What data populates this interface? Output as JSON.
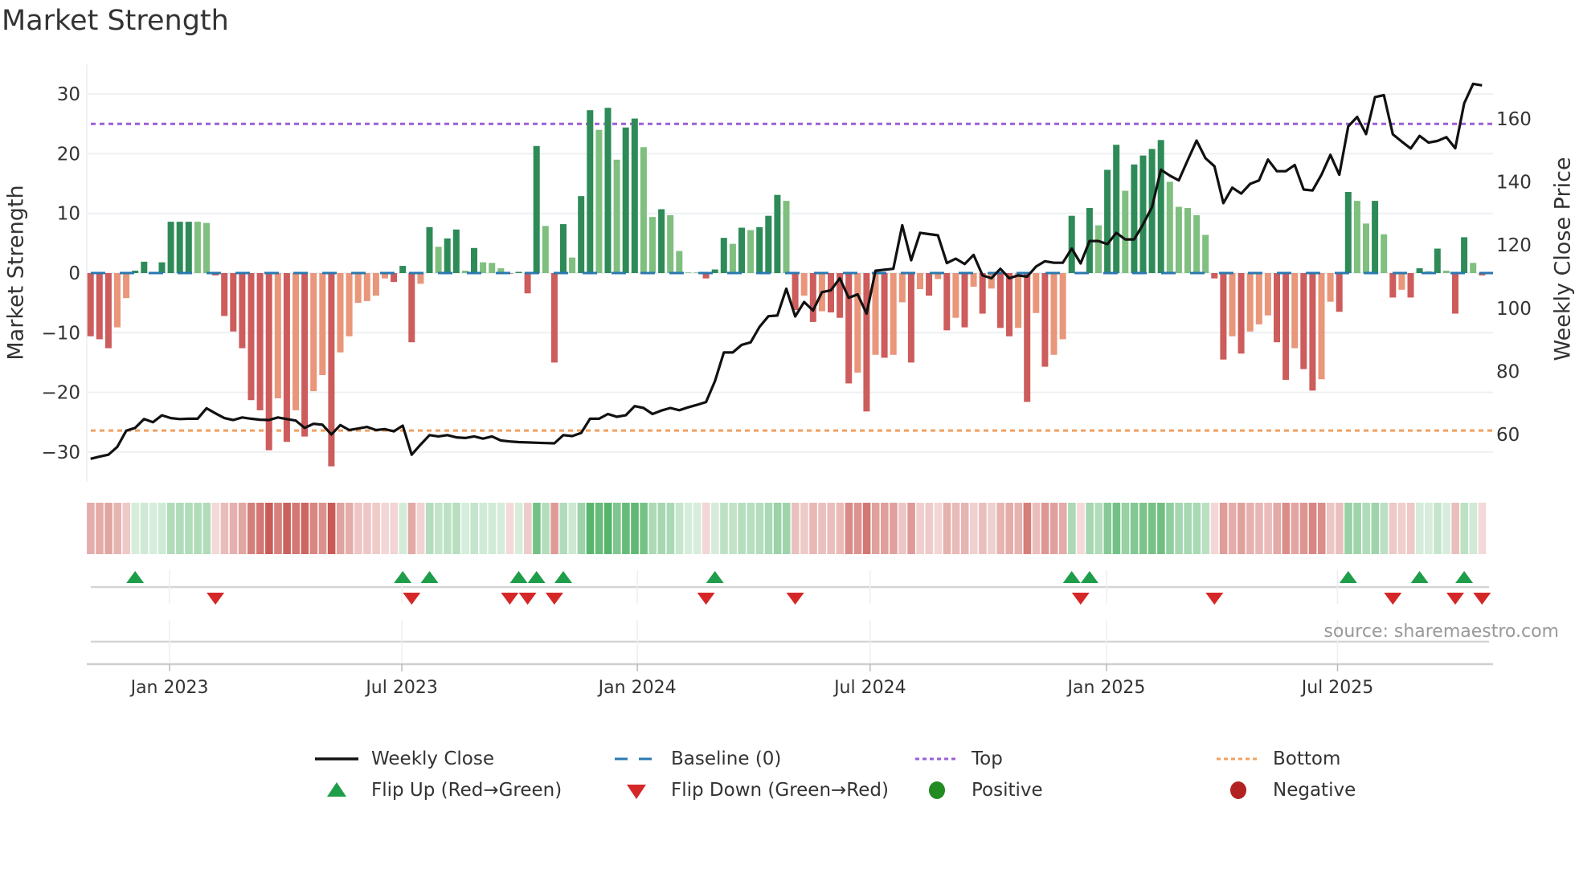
{
  "title": "Market Strength",
  "source": "source: sharemaestro.com",
  "colors": {
    "dark_green": "#2e8b57",
    "light_green": "#7fbf7f",
    "dark_red": "#cd5c5c",
    "salmon": "#e9967a",
    "baseline": "#2a78b0",
    "top": "#9b5fd6",
    "bottom": "#f0a060",
    "close": "#111111",
    "flip_up": "#1e9e4a",
    "flip_down": "#d62728",
    "positive": "#228b22",
    "negative": "#b22222",
    "heat_green": "#4caf62",
    "heat_red": "#c95a55"
  },
  "legend": [
    {
      "key": "close",
      "label": "Weekly Close"
    },
    {
      "key": "baseline",
      "label": "Baseline (0)"
    },
    {
      "key": "top",
      "label": "Top"
    },
    {
      "key": "bottom",
      "label": "Bottom"
    },
    {
      "key": "flip_up",
      "label": "Flip Up (Red→Green)"
    },
    {
      "key": "flip_down",
      "label": "Flip Down (Green→Red)"
    },
    {
      "key": "positive",
      "label": "Positive"
    },
    {
      "key": "negative",
      "label": "Negative"
    }
  ],
  "chart_data": {
    "type": "bar",
    "title": "Market Strength",
    "ylabel": "Market Strength",
    "y2label": "Weekly Close Price",
    "xlabel": "",
    "ylim": [
      -35,
      35
    ],
    "y2lim": [
      45,
      177.3
    ],
    "yticks": [
      {
        "v": -30,
        "label": "−30"
      },
      {
        "v": -20,
        "label": "−20"
      },
      {
        "v": -10,
        "label": "−10"
      },
      {
        "v": 0,
        "label": "0"
      },
      {
        "v": 10,
        "label": "10"
      },
      {
        "v": 20,
        "label": "20"
      },
      {
        "v": 30,
        "label": "30"
      }
    ],
    "y2ticks": [
      {
        "v": 60,
        "label": "60"
      },
      {
        "v": 80,
        "label": "80"
      },
      {
        "v": 100,
        "label": "100"
      },
      {
        "v": 120,
        "label": "120"
      },
      {
        "v": 140,
        "label": "140"
      },
      {
        "v": 160,
        "label": "160"
      }
    ],
    "xticks": [
      {
        "label": "Jan 2023",
        "week": 9.86
      },
      {
        "label": "Jul 2023",
        "week": 35.9
      },
      {
        "label": "Jan 2024",
        "week": 62.3
      },
      {
        "label": "Jul 2024",
        "week": 88.4
      },
      {
        "label": "Jan 2025",
        "week": 114.9
      },
      {
        "label": "Jul 2025",
        "week": 140.8
      }
    ],
    "grid": true,
    "top_level": 25,
    "bottom_level": -26.4,
    "baseline": 0,
    "strength": [
      -10.6,
      -11.1,
      -12.6,
      -9.1,
      -4.2,
      0.4,
      1.9,
      0.1,
      1.8,
      8.6,
      8.6,
      8.6,
      8.6,
      8.4,
      -0.4,
      -7.2,
      -9.8,
      -12.6,
      -21.3,
      -23.0,
      -29.7,
      -21.0,
      -28.3,
      -23.0,
      -27.4,
      -19.8,
      -17.1,
      -32.4,
      -13.3,
      -10.6,
      -5.0,
      -4.7,
      -3.8,
      -0.9,
      -1.5,
      1.2,
      -11.6,
      -1.8,
      7.7,
      4.4,
      5.8,
      7.3,
      0.4,
      4.2,
      1.8,
      1.7,
      0.8,
      -0.1,
      0.2,
      -3.4,
      21.3,
      7.9,
      -15.0,
      8.2,
      2.6,
      12.9,
      27.3,
      24.0,
      27.7,
      19.0,
      24.4,
      25.9,
      21.1,
      9.4,
      10.7,
      9.7,
      3.7,
      0.1,
      0.1,
      -0.9,
      0.6,
      5.9,
      4.9,
      7.6,
      7.2,
      7.7,
      9.6,
      13.1,
      12.1,
      -6.2,
      -3.8,
      -8.2,
      -6.4,
      -6.6,
      -7.5,
      -18.5,
      -16.7,
      -23.2,
      -13.7,
      -14.2,
      -13.7,
      -4.9,
      -15.0,
      -2.7,
      -3.8,
      -1.0,
      -9.6,
      -7.5,
      -9.1,
      -2.3,
      -6.8,
      -2.6,
      -9.2,
      -10.6,
      -9.2,
      -21.6,
      -6.7,
      -15.7,
      -13.7,
      -11.1,
      9.6,
      -0.2,
      10.9,
      8.0,
      17.3,
      21.5,
      13.8,
      18.2,
      19.7,
      20.8,
      22.3,
      15.3,
      11.1,
      10.9,
      9.7,
      6.4,
      -0.9,
      -14.5,
      -10.6,
      -13.5,
      -9.8,
      -8.6,
      -7.1,
      -11.6,
      -17.9,
      -12.6,
      -16.1,
      -19.7,
      -17.8,
      -4.8,
      -6.5,
      13.6,
      12.1,
      8.3,
      12.1,
      6.5,
      -4.1,
      -2.8,
      -4.1,
      0.8,
      0.3,
      4.1,
      0.4,
      -6.8,
      6.0,
      1.7,
      -0.4
    ],
    "tone": "RRRSSDDDDDDDLLRRRRRRRSRSRSSRSSSSSSRDRSDLDDLDLLLRDRDLRDLDDLDLDDLLDLLLLRDDLDLDDDLRSRSRRRSRSRSSRSRSRSRSRSRRSRSRSSDRDLDDLDDDDLLLLLRRSRSSSRRSRRSSRDLLDLRSRDLDLRDLR",
    "close": [
      52.3,
      53,
      53.6,
      56.1,
      61.2,
      62.1,
      64.9,
      63.9,
      66.1,
      65.2,
      64.9,
      65,
      65,
      68.3,
      66.7,
      65.2,
      64.6,
      65.4,
      65,
      64.7,
      64.6,
      65.4,
      64.9,
      64.4,
      62.1,
      63.4,
      63.1,
      60,
      63,
      61.4,
      61.9,
      62.4,
      61.4,
      61.7,
      61,
      62.8,
      53.6,
      56.8,
      59.8,
      59.4,
      59.8,
      59.1,
      58.9,
      59.4,
      58.7,
      59.4,
      58.1,
      57.8,
      57.6,
      57.5,
      57.4,
      57.3,
      57.2,
      59.8,
      59.5,
      60.5,
      65,
      65,
      66.5,
      65.6,
      66.1,
      69,
      68.4,
      66.5,
      67.6,
      68.4,
      67.7,
      68.6,
      69.4,
      70.3,
      76.9,
      86,
      86,
      88.4,
      89.2,
      94.1,
      97.5,
      97.7,
      106.2,
      97.4,
      102,
      99.3,
      105.1,
      105.7,
      109.5,
      103.3,
      104.4,
      98.3,
      111.9,
      112.2,
      112.5,
      126.3,
      115.2,
      123.9,
      123.5,
      123.1,
      114.3,
      115.7,
      114,
      116.9,
      110.4,
      109.5,
      112.5,
      109.5,
      110.4,
      110,
      113.2,
      114.9,
      114.4,
      114.4,
      118.9,
      114.2,
      121.3,
      121.3,
      120.3,
      123.9,
      121.8,
      121.8,
      126.6,
      132,
      143.9,
      142,
      140.5,
      146.9,
      153.1,
      147.5,
      145,
      133.3,
      138.2,
      136.3,
      139.4,
      140.5,
      147.1,
      143.4,
      143.4,
      145.4,
      137.6,
      137.3,
      142.3,
      148.6,
      142.3,
      157.6,
      160.6,
      155.2,
      166.9,
      167.5,
      155.1,
      152.8,
      150.6,
      154.6,
      152.5,
      153,
      154.2,
      150.7,
      164.9,
      171.1,
      170.6
    ],
    "flip_up": [
      6,
      36,
      39,
      49,
      51,
      54,
      71,
      111,
      113,
      142,
      150,
      155
    ],
    "flip_down": [
      15,
      37,
      48,
      50,
      53,
      70,
      80,
      112,
      127,
      147,
      154,
      157
    ]
  }
}
